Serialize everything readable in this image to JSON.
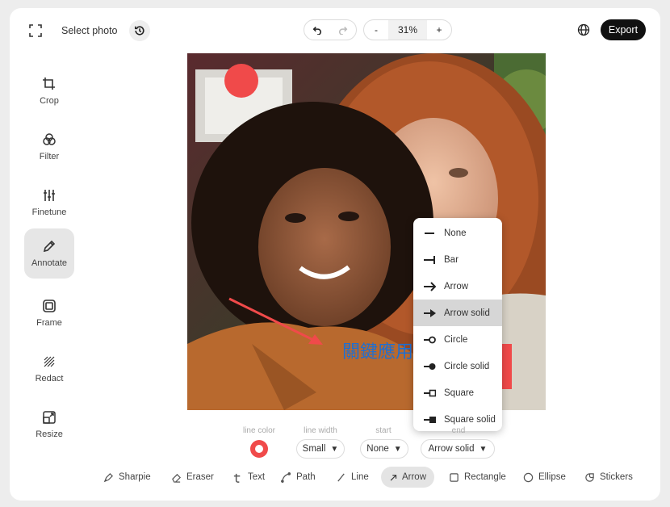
{
  "topbar": {
    "select_photo": "Select photo",
    "zoom": "31%",
    "zoom_minus": "-",
    "zoom_plus": "+",
    "export": "Export"
  },
  "sidebar": {
    "tools": [
      {
        "label": "Crop",
        "icon": "crop-icon"
      },
      {
        "label": "Filter",
        "icon": "filter-icon"
      },
      {
        "label": "Finetune",
        "icon": "finetune-icon"
      },
      {
        "label": "Annotate",
        "icon": "pencil-icon",
        "active": true
      },
      {
        "label": "Frame",
        "icon": "frame-icon"
      },
      {
        "label": "Redact",
        "icon": "redact-icon"
      },
      {
        "label": "Resize",
        "icon": "resize-icon"
      }
    ]
  },
  "canvas": {
    "overlay_text": "關鍵應用",
    "annotation_color": "#f04a4a",
    "text_color": "#1f6fd1"
  },
  "end_menu": {
    "items": [
      {
        "label": "None"
      },
      {
        "label": "Bar"
      },
      {
        "label": "Arrow"
      },
      {
        "label": "Arrow solid",
        "selected": true
      },
      {
        "label": "Circle"
      },
      {
        "label": "Circle solid"
      },
      {
        "label": "Square"
      },
      {
        "label": "Square solid"
      }
    ]
  },
  "line_options": {
    "color_label": "line color",
    "width_label": "line width",
    "start_label": "start",
    "end_label": "end",
    "width_value": "Small",
    "start_value": "None",
    "end_value": "Arrow solid",
    "caret": "▼"
  },
  "shape_tools": [
    {
      "label": "Sharpie",
      "icon": "sharpie-icon"
    },
    {
      "label": "Eraser",
      "icon": "eraser-icon"
    },
    {
      "label": "Text",
      "icon": "text-icon"
    },
    {
      "label": "Path",
      "icon": "path-icon"
    },
    {
      "label": "Line",
      "icon": "line-icon"
    },
    {
      "label": "Arrow",
      "icon": "arrow-icon",
      "active": true
    },
    {
      "label": "Rectangle",
      "icon": "rectangle-icon"
    },
    {
      "label": "Ellipse",
      "icon": "ellipse-icon"
    },
    {
      "label": "Stickers",
      "icon": "stickers-icon"
    }
  ]
}
